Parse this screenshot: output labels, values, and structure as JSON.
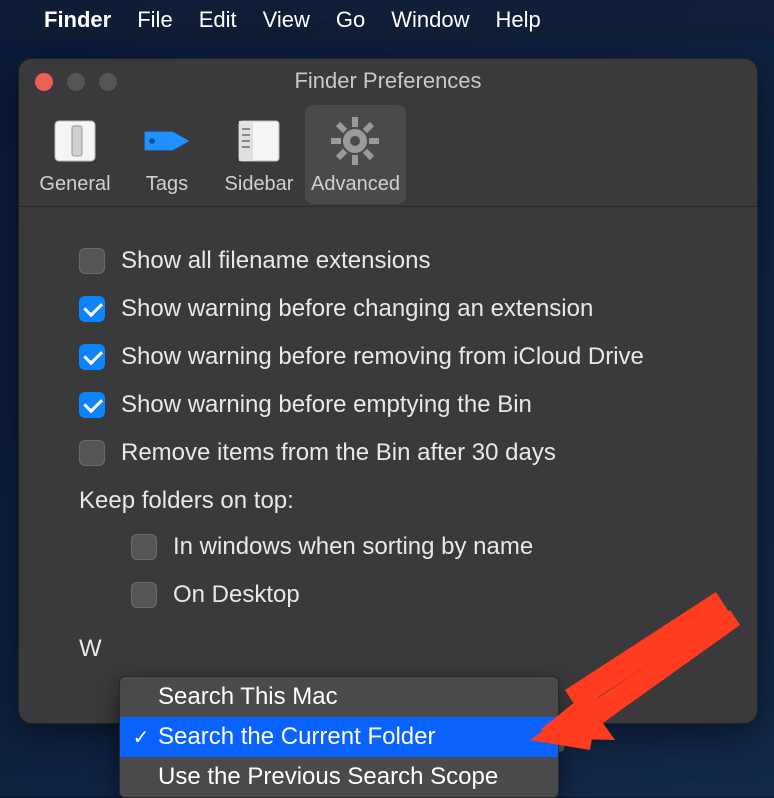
{
  "menubar": {
    "app": "Finder",
    "items": [
      "File",
      "Edit",
      "View",
      "Go",
      "Window",
      "Help"
    ]
  },
  "window": {
    "title": "Finder Preferences",
    "tabs": [
      {
        "label": "General",
        "icon": "switch-icon"
      },
      {
        "label": "Tags",
        "icon": "tag-icon"
      },
      {
        "label": "Sidebar",
        "icon": "sidebar-icon"
      },
      {
        "label": "Advanced",
        "icon": "gear-icon"
      }
    ],
    "active_tab": 3
  },
  "advanced": {
    "options": [
      {
        "checked": false,
        "label": "Show all filename extensions"
      },
      {
        "checked": true,
        "label": "Show warning before changing an extension"
      },
      {
        "checked": true,
        "label": "Show warning before removing from iCloud Drive"
      },
      {
        "checked": true,
        "label": "Show warning before emptying the Bin"
      },
      {
        "checked": false,
        "label": "Remove items from the Bin after 30 days"
      }
    ],
    "keep_on_top_label": "Keep folders on top:",
    "keep_on_top": [
      {
        "checked": false,
        "label": "In windows when sorting by name"
      },
      {
        "checked": false,
        "label": "On Desktop"
      }
    ],
    "search_section_visible_prefix": "W",
    "search_dropdown": {
      "options": [
        "Search This Mac",
        "Search the Current Folder",
        "Use the Previous Search Scope"
      ],
      "selected_index": 1
    }
  },
  "colors": {
    "accent": "#0a84ff",
    "arrow": "#ff3b20"
  }
}
